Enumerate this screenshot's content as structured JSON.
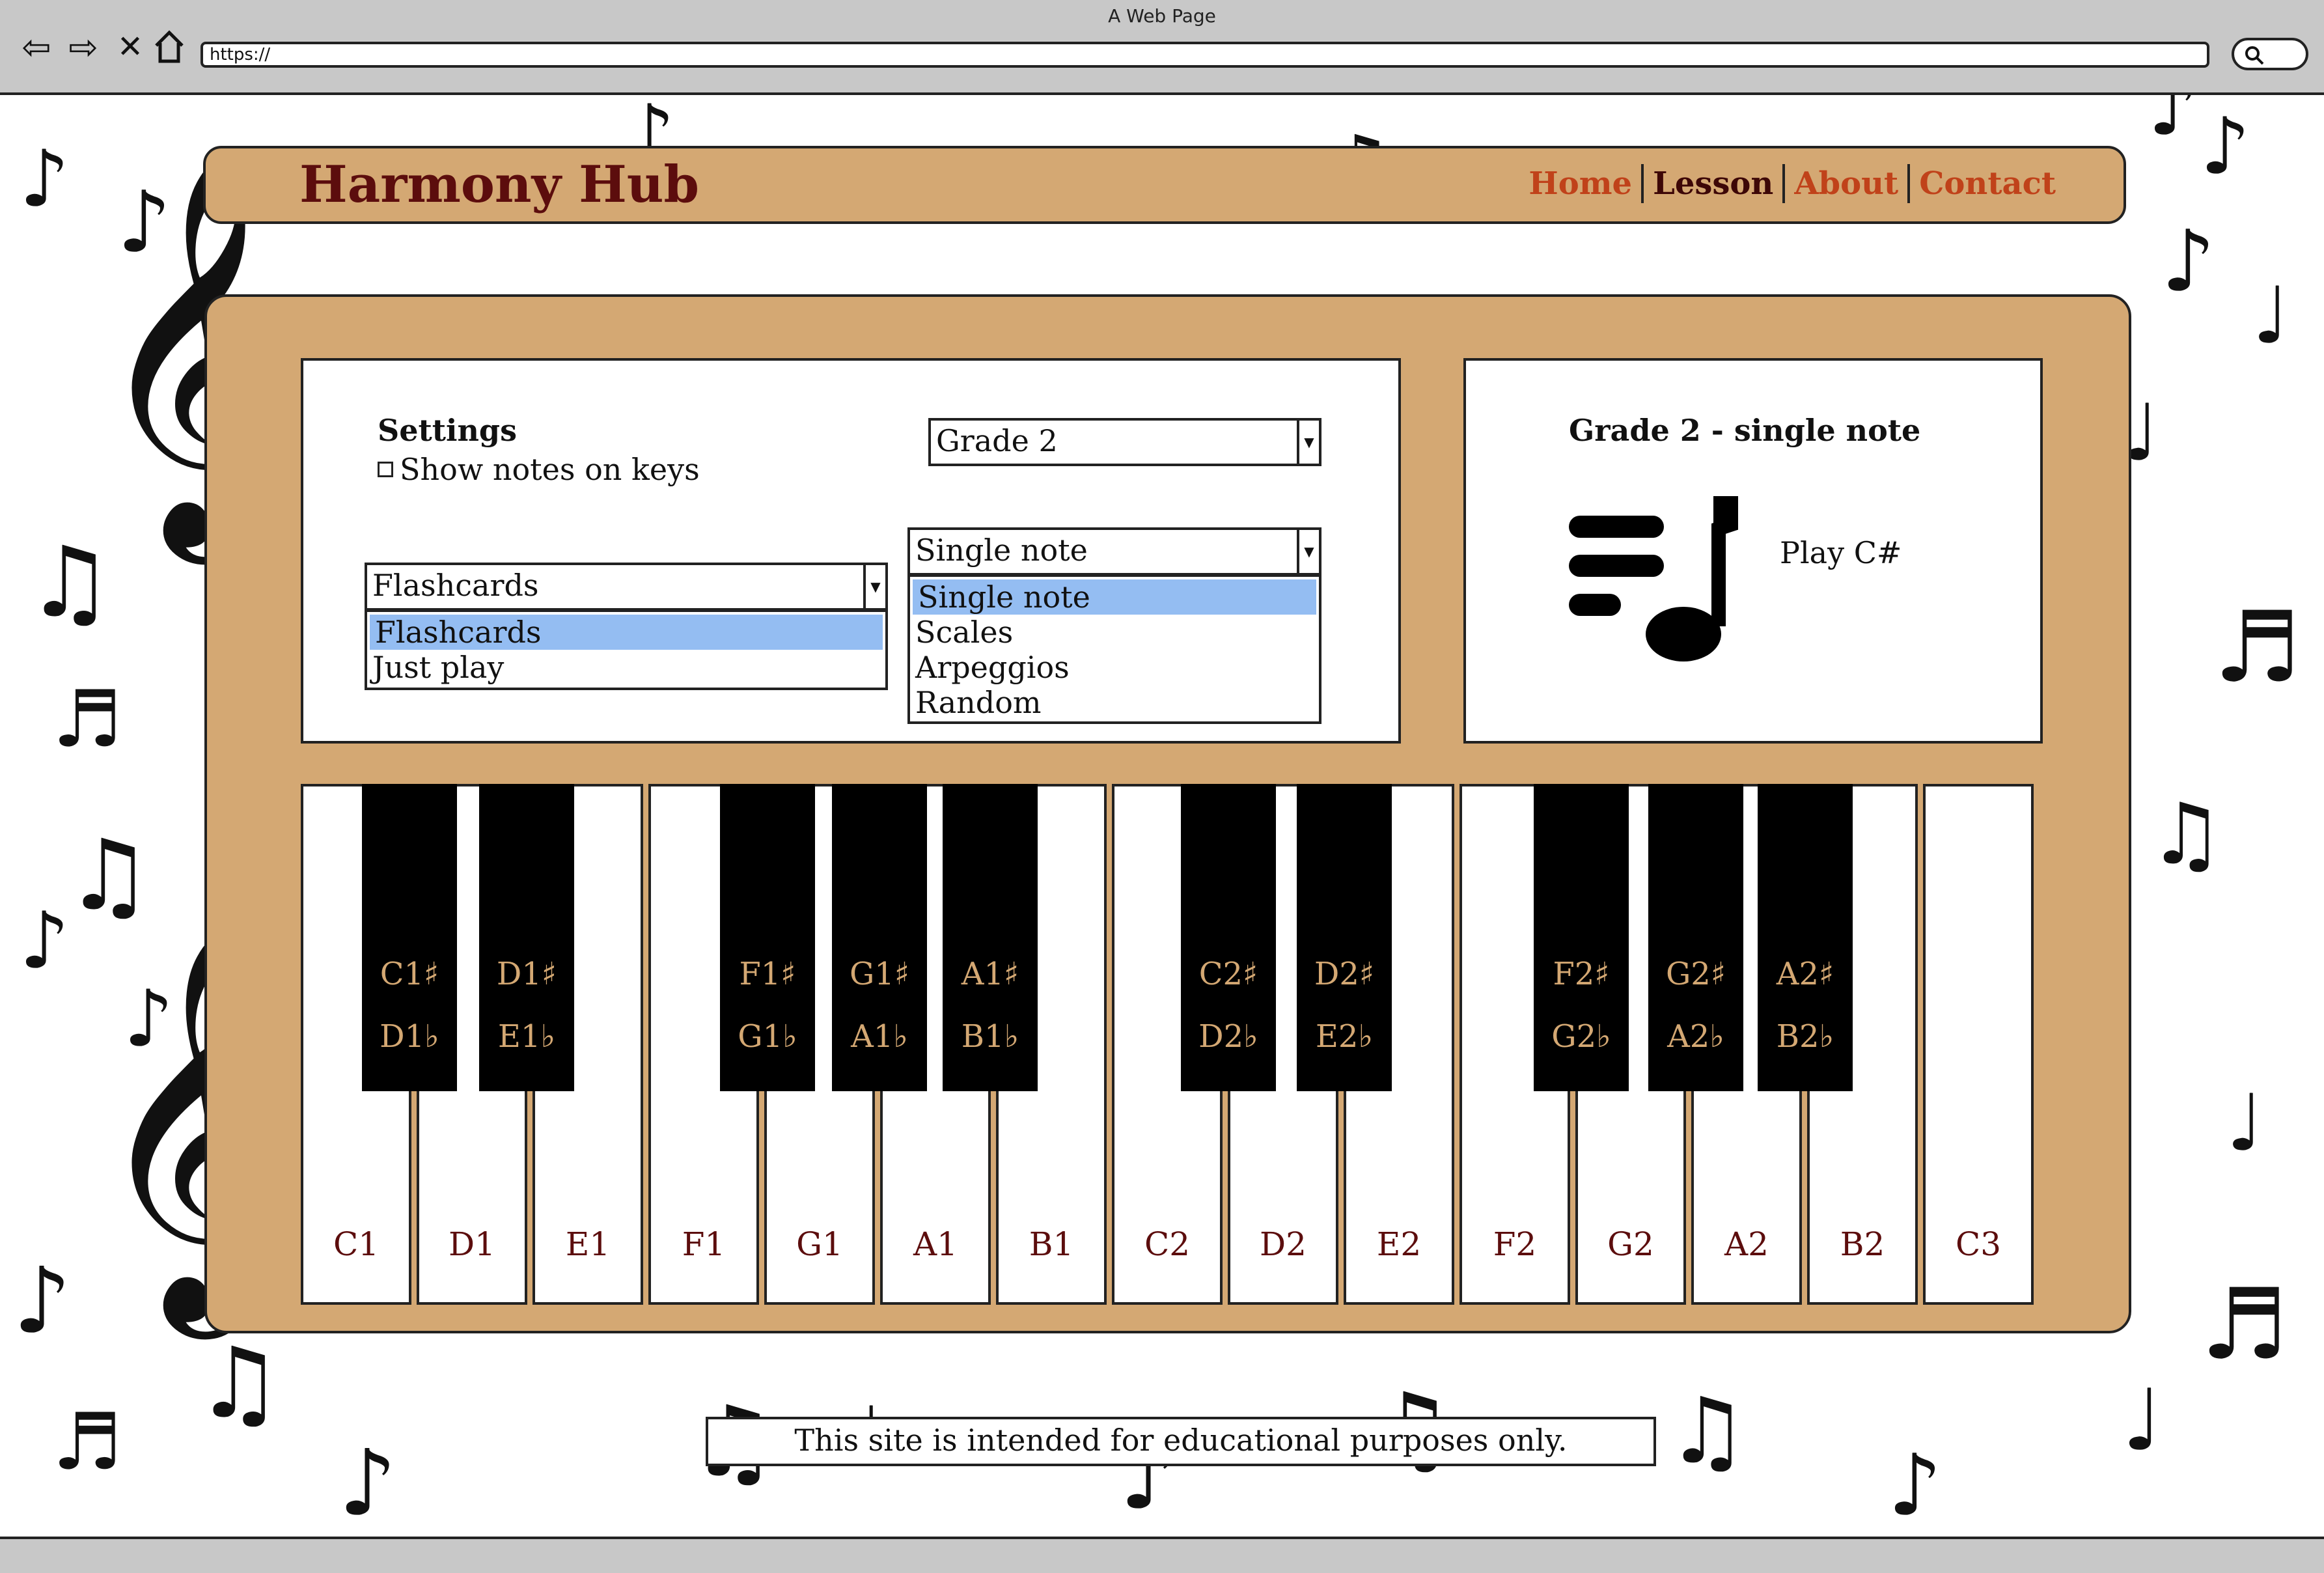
{
  "browser": {
    "window_title": "A Web Page",
    "url": "https://",
    "back_icon": "arrow-left-icon",
    "forward_icon": "arrow-right-icon",
    "close_icon": "close-icon",
    "home_icon": "home-icon",
    "search_icon": "search-icon"
  },
  "header": {
    "brand": "Harmony Hub",
    "nav": [
      {
        "label": "Home",
        "active": false
      },
      {
        "label": "Lesson",
        "active": true
      },
      {
        "label": "About",
        "active": false
      },
      {
        "label": "Contact",
        "active": false
      }
    ]
  },
  "settings": {
    "title": "Settings",
    "show_notes_label": "Show notes on keys",
    "show_notes_checked": false,
    "grade_select": {
      "value": "Grade 2"
    },
    "mode_select": {
      "value": "Flashcards",
      "options": [
        "Flashcards",
        "Just play"
      ],
      "selected_index": 0
    },
    "type_select": {
      "value": "Single note",
      "options": [
        "Single note",
        "Scales",
        "Arpeggios",
        "Random"
      ],
      "selected_index": 0
    }
  },
  "lesson": {
    "title": "Grade 2 - single note",
    "icon": "music-notes-icon",
    "prompt": "Play C#"
  },
  "piano": {
    "white_keys": [
      "C1",
      "D1",
      "E1",
      "F1",
      "G1",
      "A1",
      "B1",
      "C2",
      "D2",
      "E2",
      "F2",
      "G2",
      "A2",
      "B2",
      "C3"
    ],
    "black_keys": [
      {
        "sharp": "C1♯",
        "flat": "D1♭"
      },
      {
        "sharp": "D1♯",
        "flat": "E1♭"
      },
      {
        "sharp": "F1♯",
        "flat": "G1♭"
      },
      {
        "sharp": "G1♯",
        "flat": "A1♭"
      },
      {
        "sharp": "A1♯",
        "flat": "B1♭"
      },
      {
        "sharp": "C2♯",
        "flat": "D2♭"
      },
      {
        "sharp": "D2♯",
        "flat": "E2♭"
      },
      {
        "sharp": "F2♯",
        "flat": "G2♭"
      },
      {
        "sharp": "G2♯",
        "flat": "A2♭"
      },
      {
        "sharp": "A2♯",
        "flat": "B2♭"
      }
    ]
  },
  "footer": {
    "text": "This site is intended for educational purposes only."
  },
  "colors": {
    "accent": "#d4a873",
    "brand_text": "#5c0d0d",
    "nav_link": "#c0421a",
    "selected_option": "#94bdf2"
  }
}
